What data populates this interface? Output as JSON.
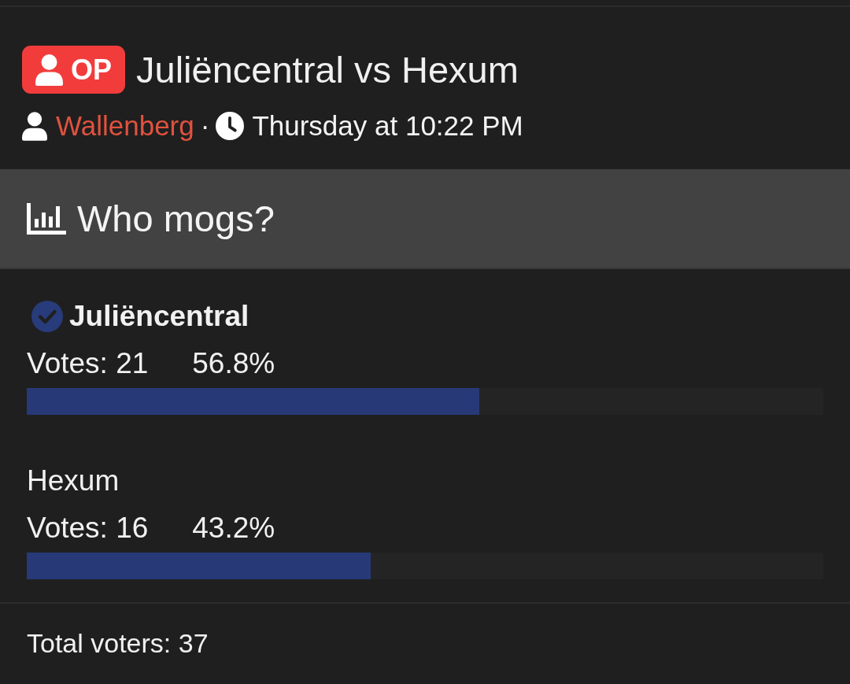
{
  "thread": {
    "badge": {
      "label": "OP"
    },
    "title": "Juliëncentral vs Hexum",
    "author": "Wallenberg",
    "separator": "·",
    "time": "Thursday at 10:22 PM"
  },
  "poll": {
    "question": "Who mogs?",
    "options": [
      {
        "name": "Juliëncentral",
        "selected": true,
        "votes": "Votes: 21",
        "percent": "56.8%",
        "level": 0.568
      },
      {
        "name": "Hexum",
        "selected": false,
        "votes": "Votes: 16",
        "percent": "43.2%",
        "level": 0.432
      }
    ],
    "total": "Total voters: 37"
  }
}
